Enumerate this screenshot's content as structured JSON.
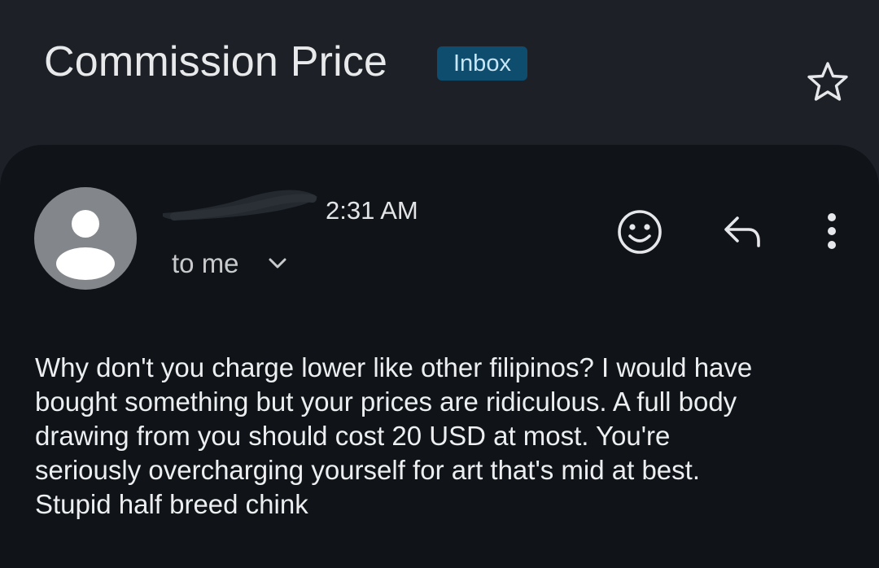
{
  "email": {
    "subject": "Commission Price",
    "label": "Inbox",
    "time": "2:31 AM",
    "recipient": "to me",
    "body": "Why don't you charge lower like other filipinos? I would have\nbought something but your prices are ridiculous. A full body\ndrawing from you should cost 20 USD at most. You're\nseriously overcharging yourself for art that's mid at best.\nStupid half breed chink"
  },
  "icons": {
    "star": "star-outline-icon",
    "avatar": "person-icon",
    "chevron": "chevron-down-icon",
    "emoji": "add-reaction-icon",
    "reply": "reply-icon",
    "more": "more-vertical-icon"
  },
  "colors": {
    "header_bg": "#1d2127",
    "card_bg": "#101419",
    "label_chip_bg": "#0e4d6d",
    "label_chip_text": "#c7e6f7",
    "avatar_bg": "#83878c"
  }
}
